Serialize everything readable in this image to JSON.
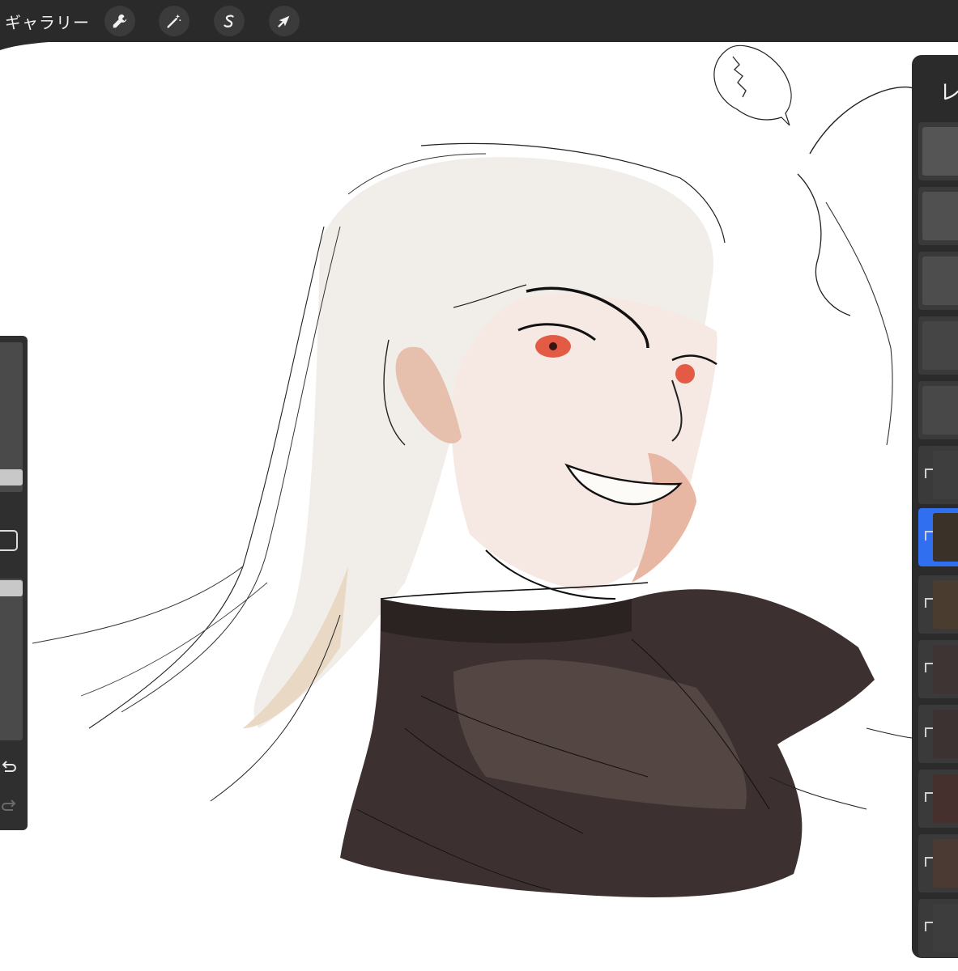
{
  "toolbar": {
    "gallery_label": "ギャラリー",
    "tools": [
      {
        "icon": "wrench-icon"
      },
      {
        "icon": "magic-wand-icon"
      },
      {
        "icon": "selection-s-icon"
      },
      {
        "icon": "arrow-cursor-icon"
      }
    ]
  },
  "layers_panel": {
    "title": "レ"
  },
  "sidebar": {
    "icons": [
      "undo-icon",
      "redo-icon"
    ]
  },
  "colors": {
    "toolbar_bg": "#2a2a2a",
    "panel_bg": "#2b2b2b",
    "active_layer": "#2f6ff0",
    "canvas_bg": "#ffffff"
  }
}
